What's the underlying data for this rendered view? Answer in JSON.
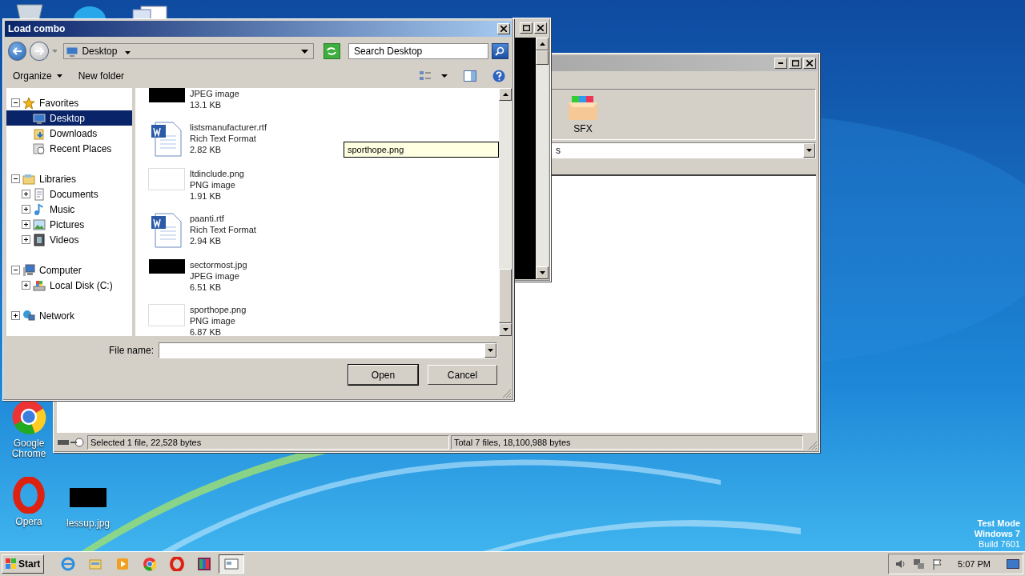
{
  "desktop_icons": [
    {
      "label": "Google Chrome",
      "kind": "chrome"
    },
    {
      "label": "Opera",
      "kind": "opera"
    },
    {
      "label": "lessup.jpg"
    }
  ],
  "system_text": [
    "Test Mode",
    "Windows 7",
    "Build 7601"
  ],
  "back_window": {
    "toolbar": [
      {
        "label": "SFX"
      }
    ],
    "address": "s",
    "status": [
      "Selected 1 file, 22,528 bytes",
      "Total 7 files, 18,100,988 bytes"
    ]
  },
  "dialog": {
    "title": "Load combo",
    "location": "Desktop",
    "search": {
      "placeholder": "Search Desktop"
    },
    "commands": [
      "Organize",
      "New folder"
    ],
    "sidebar": [
      {
        "label": "Favorites",
        "kind": "favorites",
        "selected": false,
        "expanded": true,
        "children": [
          {
            "label": "Desktop",
            "kind": "desktop",
            "selected": true
          },
          {
            "label": "Downloads",
            "kind": "downloads",
            "selected": false
          },
          {
            "label": "Recent Places",
            "kind": "recent",
            "selected": false
          }
        ]
      },
      {
        "label": "Libraries",
        "kind": "libraries",
        "selected": false,
        "expanded": true,
        "children": [
          {
            "label": "Documents",
            "kind": "documents",
            "selected": false,
            "expanded": false
          },
          {
            "label": "Music",
            "kind": "music",
            "selected": false,
            "expanded": false
          },
          {
            "label": "Pictures",
            "kind": "pictures",
            "selected": false,
            "expanded": false
          },
          {
            "label": "Videos",
            "kind": "videos",
            "selected": false,
            "expanded": false
          }
        ]
      },
      {
        "label": "Computer",
        "kind": "computer",
        "selected": false,
        "expanded": true,
        "children": [
          {
            "label": "Local Disk (C:)",
            "kind": "disk",
            "selected": false,
            "expanded": false
          }
        ]
      },
      {
        "label": "Network",
        "kind": "network",
        "selected": false,
        "expanded": false
      }
    ],
    "files": [
      {
        "kind": "dark-image",
        "type": "JPEG image",
        "size": "13.1 KB"
      },
      {
        "kind": "document",
        "name": "listsmanufacturer.rtf",
        "type": "Rich Text Format",
        "size": "2.82 KB"
      },
      {
        "kind": "light-image",
        "name": "ltdinclude.png",
        "type": "PNG image",
        "size": "1.91 KB"
      },
      {
        "kind": "document",
        "name": "paanti.rtf",
        "type": "Rich Text Format",
        "size": "2.94 KB"
      },
      {
        "kind": "dark-image",
        "name": "sectormost.jpg",
        "type": "JPEG image",
        "size": "6.51 KB"
      },
      {
        "kind": "light-image",
        "name": "sporthope.png",
        "type": "PNG image",
        "size": "6.87 KB"
      }
    ],
    "tooltip": "sporthope.png",
    "file_name": {
      "label": "File name:"
    },
    "buttons": [
      {
        "label": "Open",
        "default": true
      },
      {
        "label": "Cancel",
        "default": false
      }
    ]
  },
  "taskbar": {
    "start": "Start",
    "items": [
      {
        "kind": "browser",
        "selected": false
      },
      {
        "kind": "folder",
        "selected": false
      },
      {
        "kind": "media",
        "selected": false
      },
      {
        "kind": "chrome",
        "selected": false
      },
      {
        "kind": "opera",
        "selected": false
      },
      {
        "kind": "archive",
        "selected": false
      },
      {
        "kind": "window",
        "selected": true
      }
    ],
    "clock": "5:07 PM"
  }
}
